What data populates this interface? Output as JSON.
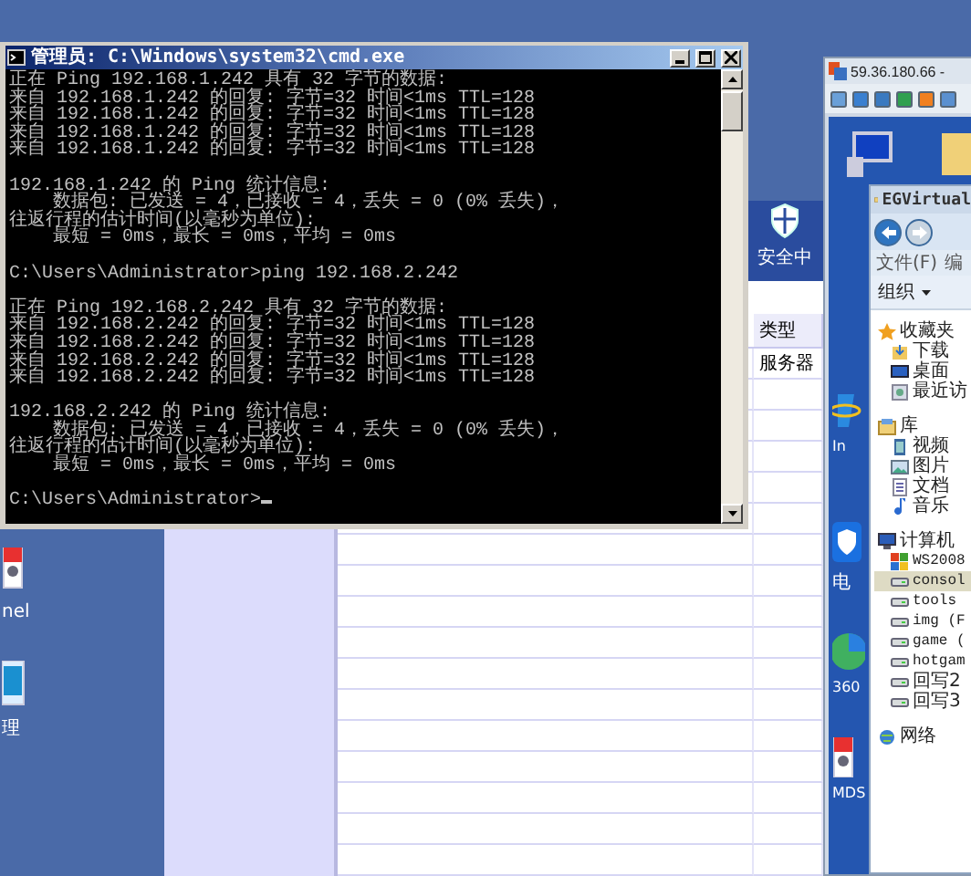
{
  "background_app": {
    "header_label": "安全中",
    "table": {
      "columns": [
        "类型"
      ],
      "rows": [
        {
          "cells": [
            "服务器"
          ]
        }
      ]
    }
  },
  "desktop_icons": [
    {
      "label": "nel",
      "kind": "app"
    },
    {
      "label": "理",
      "kind": "manager"
    }
  ],
  "cmd_window": {
    "title": "管理员: C:\\Windows\\system32\\cmd.exe",
    "cursor": true,
    "blocks": [
      [
        "正在 Ping 192.168.1.242 具有 32 字节的数据:",
        "来自 192.168.1.242 的回复: 字节=32 时间<1ms TTL=128",
        "来自 192.168.1.242 的回复: 字节=32 时间<1ms TTL=128",
        "来自 192.168.1.242 的回复: 字节=32 时间<1ms TTL=128",
        "来自 192.168.1.242 的回复: 字节=32 时间<1ms TTL=128"
      ],
      [
        "192.168.1.242 的 Ping 统计信息:",
        "    数据包: 已发送 = 4，已接收 = 4，丢失 = 0 (0% 丢失)，",
        "往返行程的估计时间(以毫秒为单位):",
        "    最短 = 0ms，最长 = 0ms，平均 = 0ms"
      ],
      [
        "C:\\Users\\Administrator>ping 192.168.2.242"
      ],
      [
        "正在 Ping 192.168.2.242 具有 32 字节的数据:",
        "来自 192.168.2.242 的回复: 字节=32 时间<1ms TTL=128",
        "来自 192.168.2.242 的回复: 字节=32 时间<1ms TTL=128",
        "来自 192.168.2.242 的回复: 字节=32 时间<1ms TTL=128",
        "来自 192.168.2.242 的回复: 字节=32 时间<1ms TTL=128"
      ],
      [
        "192.168.2.242 的 Ping 统计信息:",
        "    数据包: 已发送 = 4，已接收 = 4，丢失 = 0 (0% 丢失)，",
        "往返行程的估计时间(以毫秒为单位):",
        "    最短 = 0ms，最长 = 0ms，平均 = 0ms"
      ],
      [
        "C:\\Users\\Administrator>"
      ]
    ]
  },
  "remote_window": {
    "title": "59.36.180.66 -",
    "desktop_icons": [
      {
        "label": "In",
        "kind": "browser"
      },
      {
        "label": "电",
        "kind": "shield"
      },
      {
        "label": "360",
        "kind": "ball"
      },
      {
        "label": "MDS",
        "kind": "app"
      }
    ],
    "explorer": {
      "title": "EGVirtual",
      "menu": [
        "文件(F)",
        "编"
      ],
      "organize": "组织",
      "tree": [
        {
          "label": "收藏夹",
          "kind": "star",
          "selected": false,
          "children": [
            {
              "label": "下载",
              "kind": "download",
              "selected": false
            },
            {
              "label": "桌面",
              "kind": "desktop",
              "selected": false
            },
            {
              "label": "最近访",
              "kind": "recent",
              "selected": false
            }
          ]
        },
        {
          "label": "库",
          "kind": "library",
          "selected": false,
          "children": [
            {
              "label": "视频",
              "kind": "video",
              "selected": false
            },
            {
              "label": "图片",
              "kind": "picture",
              "selected": false
            },
            {
              "label": "文档",
              "kind": "document",
              "selected": false
            },
            {
              "label": "音乐",
              "kind": "music",
              "selected": false
            }
          ]
        },
        {
          "label": "计算机",
          "kind": "computer",
          "selected": false,
          "children": [
            {
              "label": "WS2008",
              "kind": "system",
              "selected": false
            },
            {
              "label": "consol",
              "kind": "drive",
              "selected": true
            },
            {
              "label": "tools",
              "kind": "drive",
              "selected": false
            },
            {
              "label": "img (F",
              "kind": "drive",
              "selected": false
            },
            {
              "label": "game (",
              "kind": "drive",
              "selected": false
            },
            {
              "label": "hotgam",
              "kind": "drive",
              "selected": false
            },
            {
              "label": "回写2",
              "kind": "drive",
              "selected": false
            },
            {
              "label": "回写3",
              "kind": "drive",
              "selected": false
            }
          ]
        },
        {
          "label": "网络",
          "kind": "network",
          "selected": false
        }
      ]
    }
  }
}
